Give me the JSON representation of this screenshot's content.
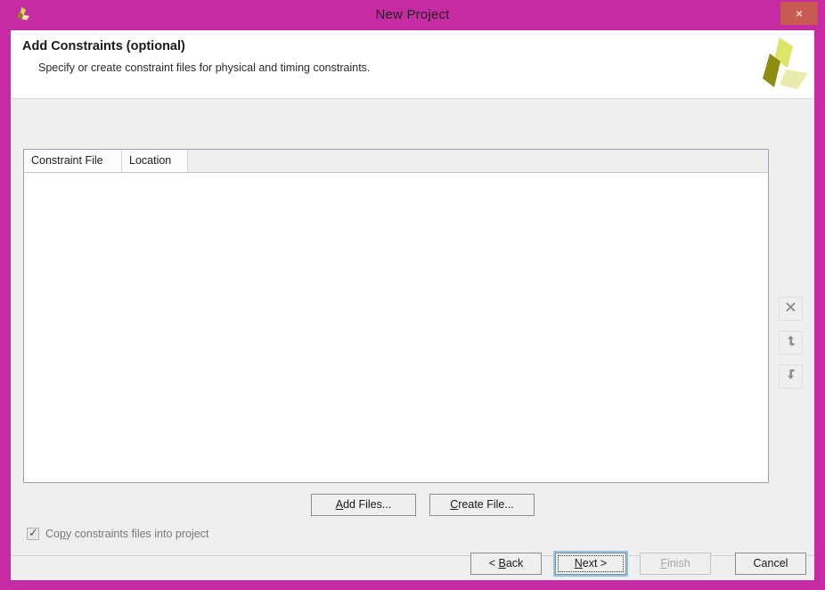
{
  "window": {
    "title": "New Project",
    "title_icon": "vivado-logo-icon",
    "close_label": "×",
    "frame_color": "#c72ba4",
    "close_color": "#c75b52"
  },
  "header": {
    "title": "Add Constraints (optional)",
    "subtitle": "Specify or create constraint files for physical and timing constraints.",
    "logo_icon": "xilinx-pinwheel-logo-icon"
  },
  "table": {
    "columns": [
      "Constraint File",
      "Location"
    ],
    "rows": []
  },
  "side_toolbar": {
    "buttons": [
      {
        "name": "remove-file-button",
        "icon": "close-x-icon",
        "enabled": false
      },
      {
        "name": "move-up-button",
        "icon": "arrow-up-icon",
        "enabled": false
      },
      {
        "name": "move-down-button",
        "icon": "arrow-down-icon",
        "enabled": false
      }
    ]
  },
  "file_actions": {
    "add_files": {
      "pre": "",
      "accel": "A",
      "post": "dd Files..."
    },
    "create_file": {
      "pre": "",
      "accel": "C",
      "post": "reate File..."
    }
  },
  "copy_option": {
    "checked": true,
    "pre": "Co",
    "accel": "p",
    "post": "y constraints files into project",
    "enabled": false,
    "tick": "✓"
  },
  "footer": {
    "back": {
      "pre": "< ",
      "accel": "B",
      "post": "ack",
      "enabled": true,
      "focused": false
    },
    "next": {
      "pre": "",
      "accel": "N",
      "post": "ext >",
      "enabled": true,
      "focused": true
    },
    "finish": {
      "pre": "",
      "accel": "F",
      "post": "inish",
      "enabled": false,
      "focused": false
    },
    "cancel": {
      "pre": "",
      "accel": "",
      "post": "Cancel",
      "enabled": true,
      "focused": false
    }
  }
}
